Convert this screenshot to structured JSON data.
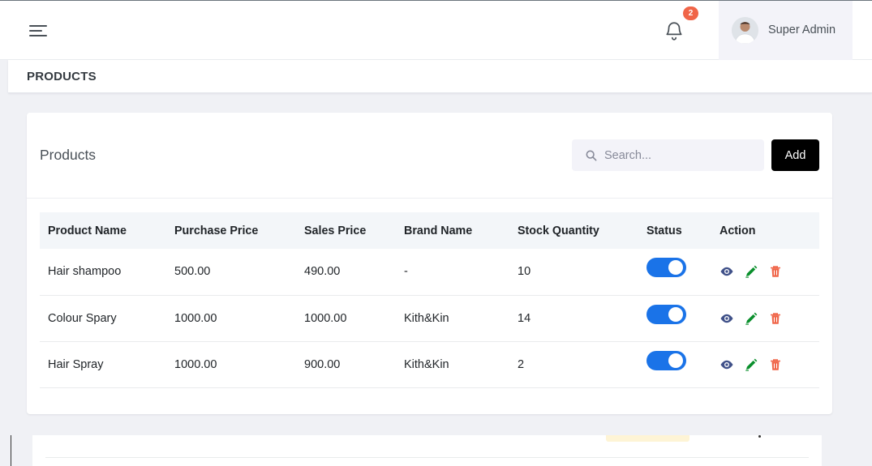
{
  "header": {
    "notification_count": "2",
    "user_name": "Super Admin"
  },
  "page": {
    "title": "PRODUCTS"
  },
  "card": {
    "title": "Products",
    "search_placeholder": "Search...",
    "add_label": "Add"
  },
  "table": {
    "columns": [
      "Product Name",
      "Purchase Price",
      "Sales Price",
      "Brand Name",
      "Stock Quantity",
      "Status",
      "Action"
    ],
    "rows": [
      {
        "name": "Hair shampoo",
        "purchase_price": "500.00",
        "sales_price": "490.00",
        "brand": "-",
        "stock": "10",
        "status_on": true
      },
      {
        "name": "Colour Spary",
        "purchase_price": "1000.00",
        "sales_price": "1000.00",
        "brand": "Kith&Kin",
        "stock": "14",
        "status_on": true
      },
      {
        "name": "Hair Spray",
        "purchase_price": "1000.00",
        "sales_price": "900.00",
        "brand": "Kith&Kin",
        "stock": "2",
        "status_on": true
      }
    ]
  },
  "colors": {
    "toggle_on": "#1a73e8",
    "view_icon": "#405189",
    "edit_icon": "#0a8f2c",
    "delete_icon": "#f06548",
    "badge": "#f06548",
    "add_button": "#000000"
  },
  "icons": {
    "menu": "hamburger-icon",
    "bell": "bell-icon",
    "search": "search-icon",
    "view": "eye-icon",
    "edit": "pencil-icon",
    "delete": "trash-icon"
  }
}
